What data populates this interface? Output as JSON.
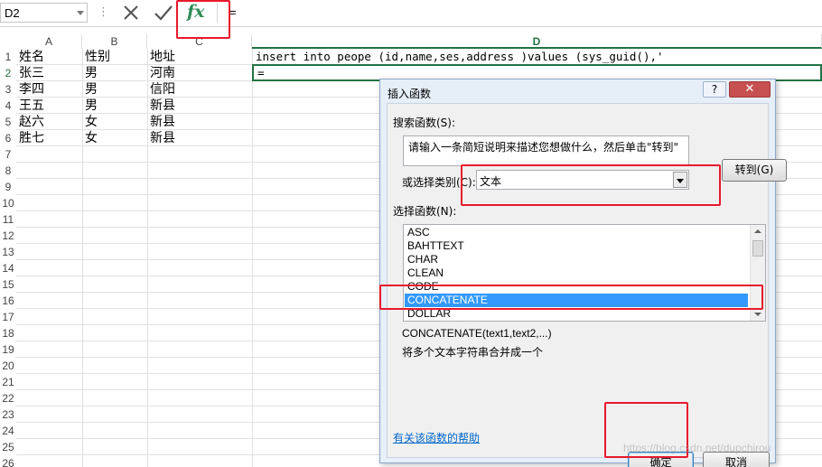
{
  "formula_bar": {
    "name_box": "D2",
    "separator": "⋮",
    "cancel_icon": "✕",
    "enter_icon": "✓",
    "fx_label": "fx",
    "content": "="
  },
  "grid": {
    "columns": [
      "A",
      "B",
      "C",
      "D"
    ],
    "active_column": "D",
    "active_row": "2",
    "row_numbers": [
      "1",
      "2",
      "3",
      "4",
      "5",
      "6",
      "7",
      "8",
      "9",
      "10",
      "11",
      "12",
      "13",
      "14",
      "15",
      "16",
      "17",
      "18",
      "19",
      "20",
      "21",
      "22",
      "23",
      "24",
      "25",
      "26"
    ],
    "rows": [
      [
        "姓名",
        "性别",
        "地址"
      ],
      [
        "张三",
        "男",
        "河南"
      ],
      [
        "李四",
        "男",
        "信阳"
      ],
      [
        "王五",
        "男",
        "新县"
      ],
      [
        "赵六",
        "女",
        "新县"
      ],
      [
        "胜七",
        "女",
        "新县"
      ]
    ],
    "d1": "insert into peope (id,name,ses,address )values (sys_guid(),'",
    "d2": "="
  },
  "dialog": {
    "title": "插入函数",
    "help_btn": "?",
    "close_btn": "✕",
    "search_label": "搜索函数(S):",
    "search_value": "请输入一条简短说明来描述您想做什么，然后单击\"转到\"",
    "goto_btn": "转到(G)",
    "category_label": "或选择类别(C):",
    "category_value": "文本",
    "function_label": "选择函数(N):",
    "functions": [
      "ASC",
      "BAHTTEXT",
      "CHAR",
      "CLEAN",
      "CODE",
      "CONCATENATE",
      "DOLLAR"
    ],
    "selected_function": "CONCATENATE",
    "signature": "CONCATENATE(text1,text2,...)",
    "description": "将多个文本字符串合并成一个",
    "help_link": "有关该函数的帮助",
    "ok_btn": "确定",
    "cancel_btn": "取消"
  },
  "watermark": "https://blog.csdn.net/dupchirou",
  "colors": {
    "excel_green": "#217346",
    "selection_blue": "#3399ff",
    "highlight_red": "#e8192c",
    "link_blue": "#0066cc"
  }
}
